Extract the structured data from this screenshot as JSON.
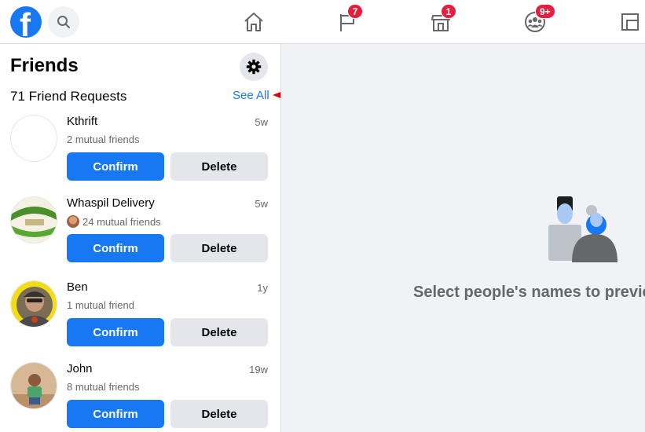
{
  "topbar": {
    "logo_letter": "f",
    "nav": {
      "pages_badge": "7",
      "marketplace_badge": "1",
      "groups_badge": "9+"
    }
  },
  "sidebar": {
    "title": "Friends",
    "requests_count": "71 Friend Requests",
    "see_all": "See All",
    "confirm_label": "Confirm",
    "delete_label": "Delete",
    "requests": [
      {
        "name": "Kthrift",
        "time": "5w",
        "mutual": "2 mutual friends"
      },
      {
        "name": "Whaspil Delivery",
        "time": "5w",
        "mutual": "24 mutual friends"
      },
      {
        "name": "Ben",
        "time": "1y",
        "mutual": "1 mutual friend"
      },
      {
        "name": "John",
        "time": "19w",
        "mutual": "8 mutual friends"
      }
    ]
  },
  "main": {
    "placeholder": "Select people's names to preview their profile."
  },
  "colors": {
    "brand": "#1877f2",
    "badge": "#e41e3f",
    "annotation_arrow": "#e00000"
  }
}
